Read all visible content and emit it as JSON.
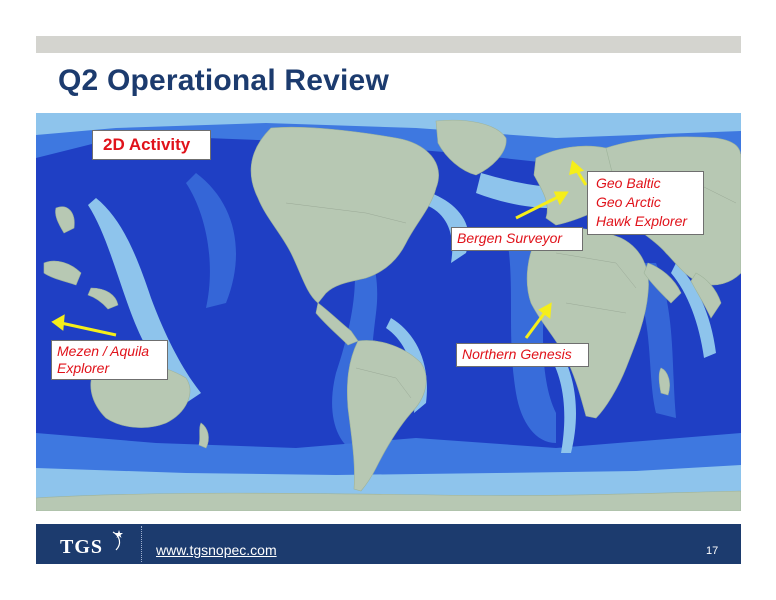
{
  "slide": {
    "title": "Q2 Operational Review",
    "page_number": "17"
  },
  "map": {
    "heading": "2D Activity",
    "labels": {
      "geo_baltic": "Geo Baltic",
      "geo_arctic": "Geo Arctic",
      "hawk_explorer": "Hawk Explorer",
      "bergen_surveyor": "Bergen Surveyor",
      "mezen_aquila": "Mezen / Aquila",
      "mezen_explorer": "Explorer",
      "northern_genesis": "Northern Genesis"
    },
    "colors": {
      "deep_ocean": "#1f3fc4",
      "mid_ocean": "#3e78e0",
      "shelf": "#8ec4ec",
      "land": "#b7c8b3",
      "arrow": "#f5ee1a",
      "label_text": "#e0121a"
    }
  },
  "footer": {
    "logo_text": "TGS",
    "url": "www.tgsnopec.com",
    "background": "#1c3b6e"
  }
}
